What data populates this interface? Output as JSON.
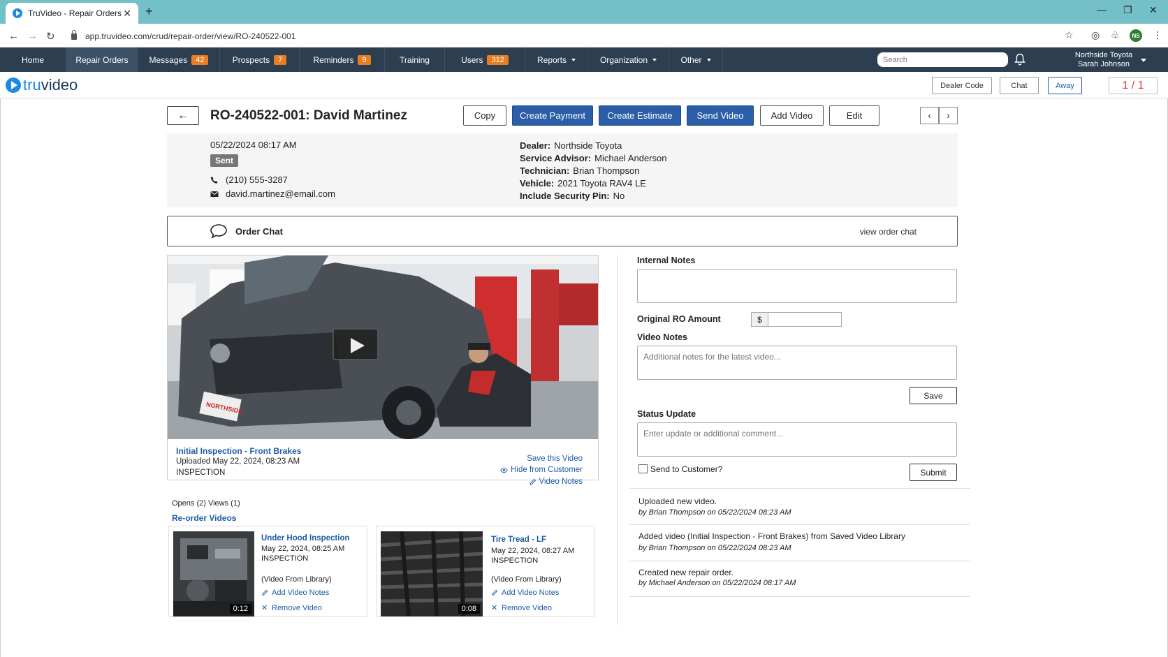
{
  "browser": {
    "tab_title": "TruVideo - Repair Orders",
    "url": "app.truvideo.com/crud/repair-order/view/RO-240522-001",
    "profile_initials": "NS"
  },
  "nav": {
    "items": [
      {
        "label": "Home"
      },
      {
        "label": "Repair Orders"
      },
      {
        "label": "Messages",
        "badge": "42"
      },
      {
        "label": "Prospects",
        "badge": "7"
      },
      {
        "label": "Reminders",
        "badge": "9"
      },
      {
        "label": "Training"
      },
      {
        "label": "Users",
        "badge": "312"
      },
      {
        "label": "Reports"
      },
      {
        "label": "Organization"
      },
      {
        "label": "Other"
      }
    ],
    "search_placeholder": "Search",
    "dealer": "Northside Toyota",
    "user": "Sarah Johnson"
  },
  "logo": {
    "part1": "tru",
    "part2": "video"
  },
  "topbar": {
    "dealer_code": "Dealer Code",
    "chat": "Chat",
    "away": "Away",
    "counter": "1 / 1"
  },
  "ro": {
    "title": "RO-240522-001: David Martinez",
    "buttons": {
      "copy": "Copy",
      "create_payment": "Create Payment",
      "create_estimate": "Create Estimate",
      "send_video": "Send Video",
      "add_video": "Add Video",
      "edit": "Edit"
    },
    "date": "05/22/2024 08:17 AM",
    "status": "Sent",
    "phone": "(210) 555-3287",
    "email": "david.martinez@email.com",
    "details": [
      {
        "label": "Dealer:",
        "value": "Northside Toyota"
      },
      {
        "label": "Service Advisor:",
        "value": "Michael Anderson"
      },
      {
        "label": "Technician:",
        "value": "Brian Thompson"
      },
      {
        "label": "Vehicle:",
        "value": "2021 Toyota RAV4 LE"
      },
      {
        "label": "Include Security Pin:",
        "value": "No"
      }
    ]
  },
  "order_chat": {
    "label": "Order Chat",
    "link": "view order chat"
  },
  "video": {
    "title": "Initial Inspection - Front Brakes",
    "uploaded": "Uploaded May 22, 2024, 08:23 AM",
    "type": "INSPECTION",
    "save": "Save this Video",
    "hide": "Hide from Customer",
    "notes": "Video Notes",
    "plate_text": "NORTHSIDE"
  },
  "stats": "Opens (2) Views (1)",
  "reorder_label": "Re-order Videos",
  "thumbs": [
    {
      "title": "Under Hood Inspection",
      "date": "May 22, 2024, 08:25 AM",
      "type": "INSPECTION",
      "source": "(Video From Library)",
      "add_notes": "Add Video Notes",
      "remove": "Remove Video",
      "duration": "0:12"
    },
    {
      "title": "Tire Tread - LF",
      "date": "May 22, 2024, 08:27 AM",
      "type": "INSPECTION",
      "source": "(Video From Library)",
      "add_notes": "Add Video Notes",
      "remove": "Remove Video",
      "duration": "0:08"
    }
  ],
  "right": {
    "internal_notes": "Internal Notes",
    "original_ro": "Original RO Amount",
    "currency": "$",
    "video_notes": "Video Notes",
    "video_notes_placeholder": "Additional notes for the latest video...",
    "save": "Save",
    "status_update": "Status Update",
    "status_placeholder": "Enter update or additional comment...",
    "send_customer": "Send to Customer?",
    "submit": "Submit"
  },
  "history": [
    {
      "text": "Uploaded new video.",
      "by": "by Brian Thompson on 05/22/2024 08:23 AM"
    },
    {
      "text": "Added video (Initial Inspection - Front Brakes) from Saved Video Library",
      "by": "by Brian Thompson on 05/22/2024 08:23 AM"
    },
    {
      "text": "Created new repair order.",
      "by": "by Michael Anderson on 05/22/2024 08:17 AM"
    }
  ]
}
